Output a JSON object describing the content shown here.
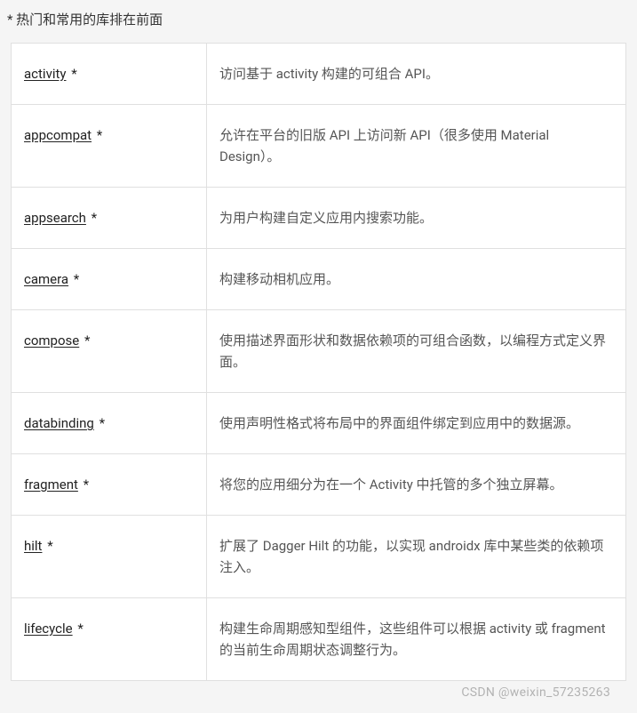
{
  "header_note": "* 热门和常用的库排在前面",
  "star": " *",
  "libraries": [
    {
      "name": "activity",
      "desc": "访问基于 activity 构建的可组合 API。"
    },
    {
      "name": "appcompat",
      "desc": "允许在平台的旧版 API 上访问新 API（很多使用 Material Design）。"
    },
    {
      "name": "appsearch",
      "desc": "为用户构建自定义应用内搜索功能。"
    },
    {
      "name": "camera",
      "desc": "构建移动相机应用。"
    },
    {
      "name": "compose",
      "desc": "使用描述界面形状和数据依赖项的可组合函数，以编程方式定义界面。"
    },
    {
      "name": "databinding",
      "desc": "使用声明性格式将布局中的界面组件绑定到应用中的数据源。"
    },
    {
      "name": "fragment",
      "desc": "将您的应用细分为在一个 Activity 中托管的多个独立屏幕。"
    },
    {
      "name": "hilt",
      "desc": "扩展了 Dagger Hilt 的功能，以实现 androidx 库中某些类的依赖项注入。"
    },
    {
      "name": "lifecycle",
      "desc": "构建生命周期感知型组件，这些组件可以根据 activity 或 fragment 的当前生命周期状态调整行为。"
    }
  ],
  "watermark": "CSDN @weixin_57235263"
}
